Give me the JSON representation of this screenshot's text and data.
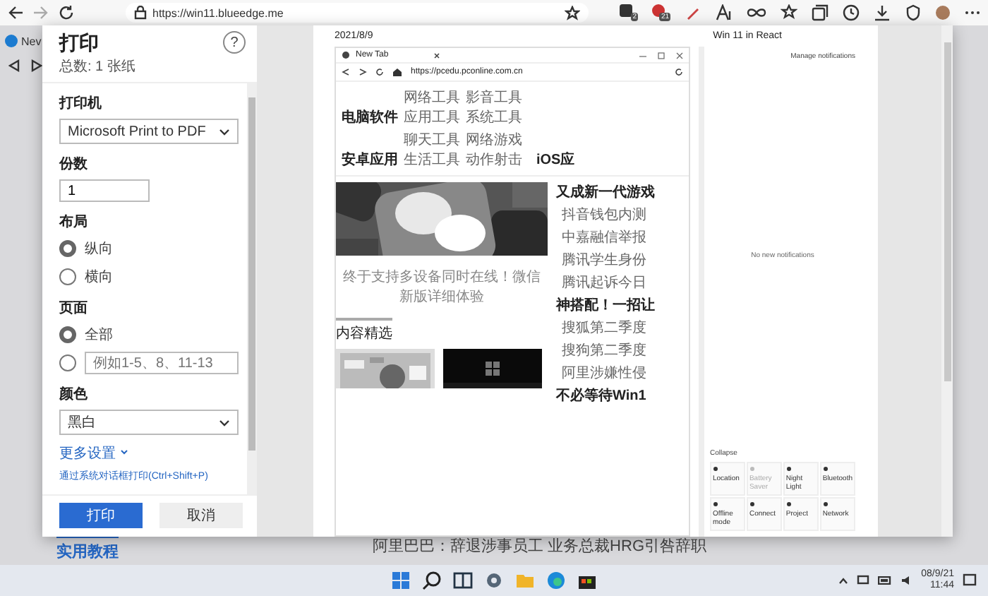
{
  "browser": {
    "address": "https://win11.blueedge.me",
    "extensions": [
      {
        "badge": "2"
      },
      {
        "badge": "21"
      }
    ]
  },
  "background_page": {
    "tab": "Nev",
    "headline": "阿里巴巴：辞退涉事员工 业务总裁HRG引咎辞职",
    "section": "实用教程"
  },
  "print_dialog": {
    "title": "打印",
    "total": "总数: 1 张纸",
    "help": "?",
    "printer": {
      "label": "打印机",
      "value": "Microsoft Print to PDF"
    },
    "copies": {
      "label": "份数",
      "value": "1"
    },
    "layout": {
      "label": "布局",
      "options": [
        {
          "kind": "text",
          "label": "纵向",
          "selected": true
        },
        {
          "kind": "text",
          "label": "横向",
          "selected": false
        }
      ]
    },
    "pages": {
      "label": "页面",
      "options": [
        {
          "kind": "text",
          "label": "全部",
          "selected": true
        },
        {
          "kind": "field",
          "placeholder": "例如1-5、8、11-13",
          "selected": false
        }
      ]
    },
    "color": {
      "label": "颜色",
      "value": "黑白"
    },
    "more_settings": "更多设置",
    "system_dialog_link": "通过系统对话框打印(Ctrl+Shift+P)",
    "buttons": [
      {
        "label": "打印",
        "kind": "primary"
      },
      {
        "label": "取消",
        "kind": "secondary"
      }
    ]
  },
  "preview": {
    "date": "2021/8/9",
    "title": "Win 11 in React",
    "window": {
      "tab": "New Tab",
      "address": "https://pcedu.pconline.com.cn",
      "nav": [
        {
          "category": "电脑软件",
          "links": [
            "网络工具",
            "影音工具",
            "应用工具",
            "系统工具"
          ]
        },
        {
          "category": "安卓应用",
          "links": [
            "聊天工具",
            "网络游戏",
            "生活工具",
            "动作射击"
          ]
        }
      ],
      "nav_tail": "iOS应",
      "caption": "终于支持多设备同时在线！微信新版详细体验",
      "section": "内容精选",
      "headlines": [
        {
          "kind": "heading",
          "text": "又成新一代游戏"
        },
        {
          "kind": "item",
          "text": "抖音钱包内测"
        },
        {
          "kind": "item",
          "text": "中嘉融信举报"
        },
        {
          "kind": "item",
          "text": "腾讯学生身份"
        },
        {
          "kind": "item",
          "text": "腾讯起诉今日"
        },
        {
          "kind": "heading",
          "text": "神搭配！一招让"
        },
        {
          "kind": "item",
          "text": "搜狐第二季度"
        },
        {
          "kind": "item",
          "text": "搜狗第二季度"
        },
        {
          "kind": "item",
          "text": "阿里涉嫌性侵"
        },
        {
          "kind": "heading",
          "text": "不必等待Win1"
        }
      ]
    },
    "notifications": {
      "manage": "Manage notifications",
      "empty": "No new notifications",
      "collapse": "Collapse",
      "actions": [
        {
          "label": "Location",
          "disabled": false
        },
        {
          "label": "Battery Saver",
          "disabled": true
        },
        {
          "label": "Night Light",
          "disabled": false
        },
        {
          "label": "Bluetooth",
          "disabled": false
        },
        {
          "label": "Offline mode",
          "disabled": false
        },
        {
          "label": "Connect",
          "disabled": false
        },
        {
          "label": "Project",
          "disabled": false
        },
        {
          "label": "Network",
          "disabled": false
        }
      ]
    }
  },
  "taskbar": {
    "date": "08/9/21",
    "time": "11:44"
  }
}
